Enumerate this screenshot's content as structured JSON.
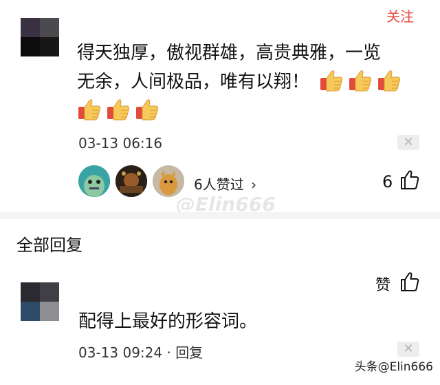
{
  "comment": {
    "follow_label": "关注",
    "text_line1": "得天独厚，傲视群雄，高贵典雅，一览",
    "text_line2": "无余，人间极品，唯有以翔！",
    "timestamp": "03-13 06:16",
    "likes_text": "6人赞过",
    "likes_chevron": "›",
    "like_count": "6"
  },
  "watermark": "@Elin666",
  "replies": {
    "section_title": "全部回复",
    "items": [
      {
        "like_label": "赞",
        "text": "配得上最好的形容词。",
        "timestamp": "03-13 09:24",
        "separator": "·",
        "reply_label": "回复"
      }
    ]
  },
  "footer": {
    "source_watermark": "头条@Elin666"
  },
  "icons": {
    "close": "close-icon",
    "thumbs_up_emoji": "thumbs-up-emoji-icon",
    "thumbs_up_outline": "thumbs-up-outline-icon"
  },
  "colors": {
    "accent": "#e84a40",
    "divider": "#f4f4f4"
  }
}
